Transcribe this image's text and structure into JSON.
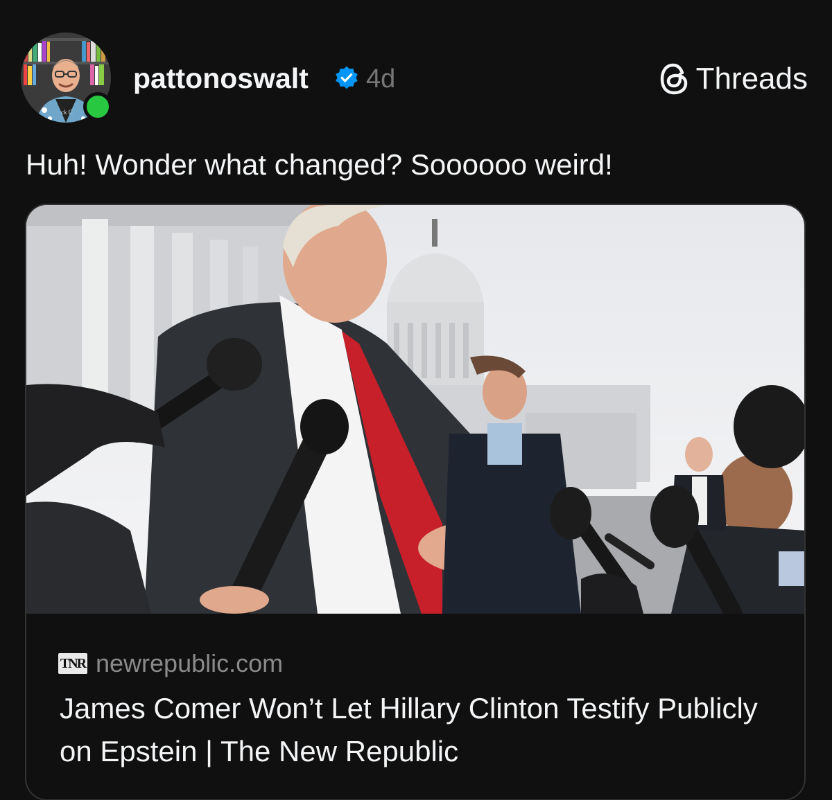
{
  "post": {
    "author": {
      "username": "pattonoswalt",
      "verified": true,
      "online": true,
      "avatar_icon": "avatar-photo"
    },
    "timestamp": "4d",
    "brand": {
      "label": "Threads",
      "icon": "threads-logo-icon"
    },
    "caption": "Huh! Wonder what changed? Soooooo weird!",
    "link_preview": {
      "image": "press-conference-photo",
      "favicon_text": "TNR",
      "domain": "newrepublic.com",
      "title": "James Comer Won’t Let Hillary Clinton Testify Publicly on Epstein | The New Republic"
    }
  },
  "colors": {
    "background": "#101010",
    "text_primary": "#f3f5f7",
    "text_secondary": "#777777",
    "verified_blue": "#0095f6",
    "online_green": "#28c840",
    "card_border": "#333333"
  }
}
